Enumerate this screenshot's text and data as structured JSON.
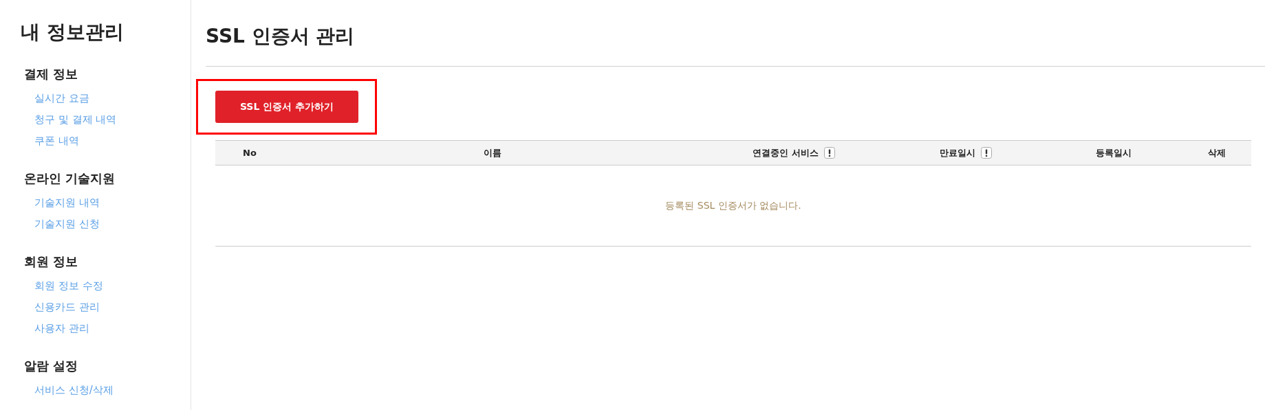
{
  "sidebar": {
    "title": "내 정보관리",
    "sections": [
      {
        "title": "결제 정보",
        "items": [
          "실시간 요금",
          "청구 및 결제 내역",
          "쿠폰 내역"
        ]
      },
      {
        "title": "온라인 기술지원",
        "items": [
          "기술지원 내역",
          "기술지원 신청"
        ]
      },
      {
        "title": "회원 정보",
        "items": [
          "회원 정보 수정",
          "신용카드 관리",
          "사용자 관리"
        ]
      },
      {
        "title": "알람 설정",
        "items": [
          "서비스 신청/삭제"
        ]
      }
    ]
  },
  "page_title": "SSL 인증서 관리",
  "add_button": {
    "label": "SSL 인증서 추가하기",
    "highlighted": true
  },
  "table": {
    "columns": [
      {
        "label": "No",
        "has_info": false
      },
      {
        "label": "이름",
        "has_info": false
      },
      {
        "label": "연결중인 서비스",
        "has_info": true
      },
      {
        "label": "만료일시",
        "has_info": true
      },
      {
        "label": "등록일시",
        "has_info": false
      },
      {
        "label": "삭제",
        "has_info": false
      }
    ],
    "empty_message": "등록된 SSL 인증서가 없습니다."
  }
}
